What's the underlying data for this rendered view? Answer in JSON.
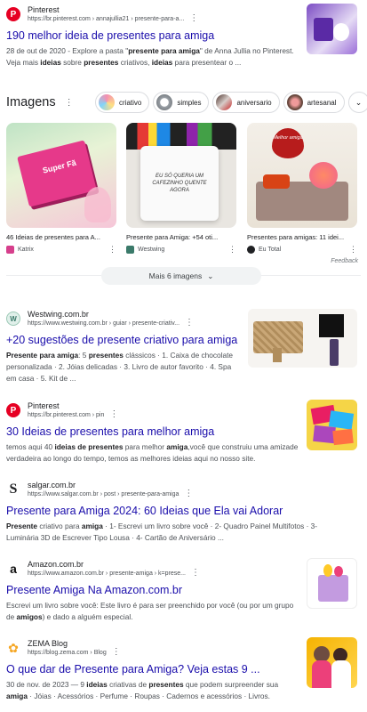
{
  "results_top": {
    "source": "Pinterest",
    "url": "https://br.pinterest.com › annajullia21 › presente-para-a...",
    "title": "190 melhor ideia de presentes para amiga",
    "snippet_html": "28 de out de 2020 - Explore a pasta \"<b>presente para amiga</b>\" de Anna Jullia no Pinterest. Veja mais <b>ideias</b> sobre <b>presentes</b> criativos, <b>ideias</b> para presentear o ..."
  },
  "images": {
    "heading": "Imagens",
    "chips": [
      "criativo",
      "simples",
      "aniversario",
      "artesanal"
    ],
    "cards": [
      {
        "caption": "46 Ideias de presentes para A...",
        "source": "Katrix",
        "source_color": "#d63f8c",
        "photo_text": "Super Fã"
      },
      {
        "caption": "Presente para Amiga: +54 oti...",
        "source": "Westwing",
        "source_color": "#3b7a6a",
        "photo_text": "EU SÓ QUERIA UM CAFEZINHO QUENTE AGORA"
      },
      {
        "caption": "Presentes para amigas: 11 idei...",
        "source": "Eu Total",
        "source_color": "#202124",
        "photo_text": "Melhor amiga"
      }
    ],
    "feedback": "Feedback",
    "more_label": "Mais 6 imagens"
  },
  "results": [
    {
      "source": "Westwing.com.br",
      "url": "https://www.westwing.com.br › guiar › presente-criativ...",
      "title": "+20 sugestões de presente criativo para amiga",
      "snippet_html": "<b>Presente para amiga</b>: 5 <b>presentes</b> clássicos · 1. Caixa de chocolate personalizada · 2. Jóias delicadas · 3. Livro de autor favorito · 4. Spa em casa · 5. Kit de ..."
    },
    {
      "source": "Pinterest",
      "url": "https://br.pinterest.com › pin",
      "title": "30 Ideias de presentes para melhor amiga",
      "snippet_html": "temos aqui 40 <b>ideias de presentes</b> para melhor <b>amiga</b>,você que construiu uma amizade verdadeira ao longo do tempo, temos as melhores ideias aqui no nosso site."
    },
    {
      "source": "salgar.com.br",
      "url": "https://www.salgar.com.br › post › presente-para-amiga",
      "title": "Presente para Amiga 2024: 60 Ideias que Ela vai Adorar",
      "snippet_html": "<b>Presente</b> criativo para <b>amiga</b> · 1- Escrevi um livro sobre você · 2- Quadro Painel Multifotos · 3- Luminária 3D de Escrever Tipo Lousa · 4- Cartão de Aniversário ..."
    },
    {
      "source": "Amazon.com.br",
      "url": "https://www.amazon.com.br › presente-amiga › k=prese...",
      "title": "Presente Amiga Na Amazon.com.br",
      "snippet_html": "Escrevi um livro sobre você: Este livro é para ser preenchido por você (ou por um grupo de <b>amigos</b>) e dado a alguém especial."
    },
    {
      "source": "ZEMA Blog",
      "url": "https://blog.zema.com › Blog",
      "title": "O que dar de Presente para Amiga? Veja estas 9 ...",
      "snippet_html": "30 de nov. de 2023 — 9 <b>ideias</b> criativas de <b>presentes</b> que podem surpreender sua <b>amiga</b> · Jóias · Acessórios · Perfume · Roupas · Cadernos e acessórios · Livros."
    }
  ],
  "colors": {
    "link": "#1a0dab",
    "pinterest": "#e60023",
    "amazon": "#ff9900"
  }
}
